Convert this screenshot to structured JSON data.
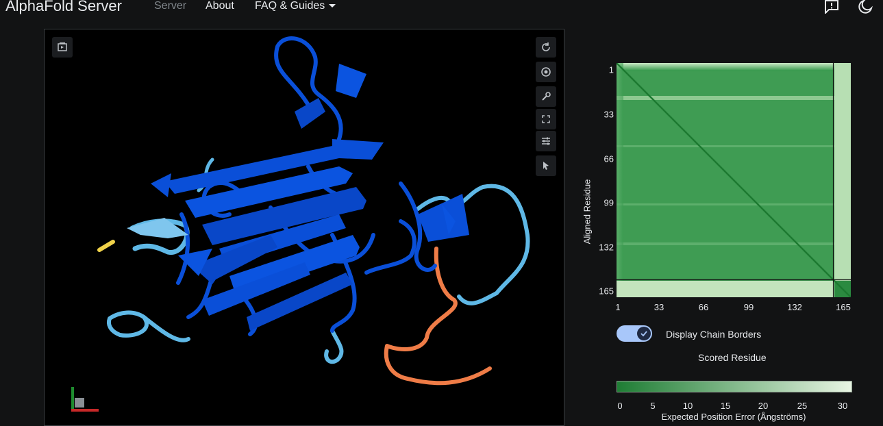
{
  "header": {
    "brand": "AlphaFold Server",
    "nav": {
      "server": "Server",
      "about": "About",
      "faq": "FAQ & Guides"
    },
    "icons": [
      "feedback-icon",
      "dark-mode-icon"
    ]
  },
  "viewer": {
    "toolbar": [
      "snapshot-icon",
      "spin-icon",
      "camera-icon",
      "wrench-icon",
      "fullscreen-icon",
      "settings-icon",
      "select-icon"
    ],
    "colors": {
      "very_high": "#0a4fd8",
      "confident": "#5fb8e6",
      "low": "#f0d24a",
      "very_low": "#ef7c47"
    }
  },
  "pae": {
    "y_axis_label": "Aligned Residue",
    "x_axis_label": "Scored Residue",
    "y_ticks": [
      "1",
      "33",
      "66",
      "99",
      "132",
      "165"
    ],
    "x_ticks": [
      "1",
      "33",
      "66",
      "99",
      "132",
      "165"
    ],
    "chain_border_toggle": {
      "label": "Display Chain Borders",
      "checked": true
    },
    "colorbar": {
      "ticks": [
        "0",
        "5",
        "10",
        "15",
        "20",
        "25",
        "30"
      ],
      "title": "Expected Position Error (Ångströms)",
      "color_low": "#1e7d34",
      "color_high": "#e8f5e3"
    }
  }
}
